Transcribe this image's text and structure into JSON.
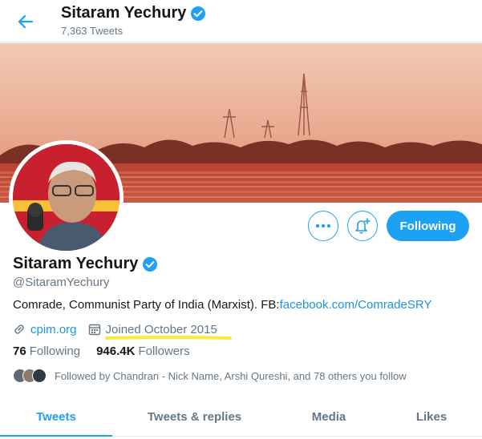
{
  "header": {
    "back_icon": "arrow-left-icon",
    "name": "Sitaram Yechury",
    "tweet_count": "7,363 Tweets"
  },
  "profile": {
    "name": "Sitaram Yechury",
    "verified_icon": "verified-badge-icon",
    "handle": "@SitaramYechury",
    "bio_text": "Comrade, Communist Party of India (Marxist). FB:",
    "bio_link": "facebook.com/ComradeSRY",
    "website": "cpim.org",
    "joined": "Joined October 2015",
    "following_count": "76",
    "following_label": "Following",
    "followers_count": "946.4K",
    "followers_label": "Followers",
    "followed_by": "Followed by Chandran - Nick Name, Arshi Qureshi, and 78 others you follow"
  },
  "actions": {
    "more_icon": "more-dots-icon",
    "notify_icon": "bell-plus-icon",
    "follow_label": "Following"
  },
  "tabs": [
    {
      "label": "Tweets",
      "active": true
    },
    {
      "label": "Tweets & replies",
      "active": false
    },
    {
      "label": "Media",
      "active": false
    },
    {
      "label": "Likes",
      "active": false
    }
  ],
  "colors": {
    "accent": "#1da1f2",
    "link": "#1b95e0",
    "secondary_text": "#657786",
    "highlight": "#f4ef3a"
  }
}
